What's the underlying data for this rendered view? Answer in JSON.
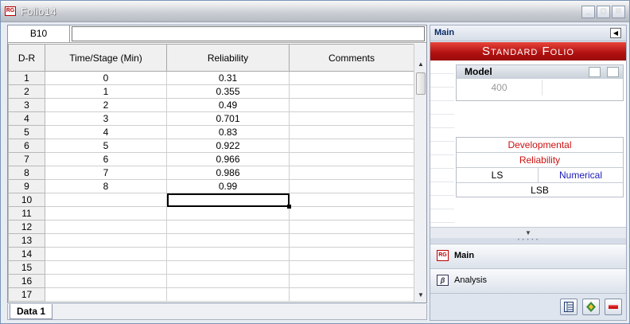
{
  "window": {
    "title": "Folio14"
  },
  "formula_bar": {
    "cell_ref": "B10",
    "value": ""
  },
  "grid": {
    "columns": [
      "D-R",
      "Time/Stage (Min)",
      "Reliability",
      "Comments"
    ],
    "rows": [
      {
        "num": "1",
        "time": "0",
        "reliability": "0.31",
        "comments": ""
      },
      {
        "num": "2",
        "time": "1",
        "reliability": "0.355",
        "comments": ""
      },
      {
        "num": "3",
        "time": "2",
        "reliability": "0.49",
        "comments": ""
      },
      {
        "num": "4",
        "time": "3",
        "reliability": "0.701",
        "comments": ""
      },
      {
        "num": "5",
        "time": "4",
        "reliability": "0.83",
        "comments": ""
      },
      {
        "num": "6",
        "time": "5",
        "reliability": "0.922",
        "comments": ""
      },
      {
        "num": "7",
        "time": "6",
        "reliability": "0.966",
        "comments": ""
      },
      {
        "num": "8",
        "time": "7",
        "reliability": "0.986",
        "comments": ""
      },
      {
        "num": "9",
        "time": "8",
        "reliability": "0.99",
        "comments": ""
      },
      {
        "num": "10",
        "time": "",
        "reliability": "",
        "comments": ""
      },
      {
        "num": "11",
        "time": "",
        "reliability": "",
        "comments": ""
      },
      {
        "num": "12",
        "time": "",
        "reliability": "",
        "comments": ""
      },
      {
        "num": "13",
        "time": "",
        "reliability": "",
        "comments": ""
      },
      {
        "num": "14",
        "time": "",
        "reliability": "",
        "comments": ""
      },
      {
        "num": "15",
        "time": "",
        "reliability": "",
        "comments": ""
      },
      {
        "num": "16",
        "time": "",
        "reliability": "",
        "comments": ""
      },
      {
        "num": "17",
        "time": "",
        "reliability": "",
        "comments": ""
      }
    ],
    "selected_cell": "B10"
  },
  "sheet_tabs": [
    {
      "label": "Data 1",
      "active": true
    }
  ],
  "panel": {
    "title": "Main",
    "banner": "Standard Folio",
    "model": {
      "label": "Model",
      "value": "400"
    },
    "settings": {
      "row1": "Developmental",
      "row2": "Reliability",
      "row3_left": "LS",
      "row3_right": "Numerical",
      "row4": "LSB"
    },
    "nav": {
      "main": "Main",
      "analysis": "Analysis"
    }
  },
  "colors": {
    "banner": "#b01010",
    "accent_blue": "#1a1ab8",
    "accent_red": "#cc1111"
  }
}
